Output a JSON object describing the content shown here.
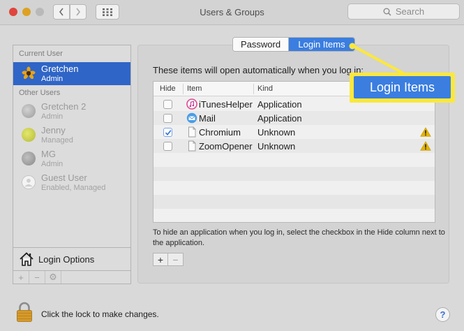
{
  "window": {
    "title": "Users & Groups",
    "search_placeholder": "Search"
  },
  "sidebar": {
    "current_user_label": "Current User",
    "other_users_label": "Other Users",
    "current_user": {
      "name": "Gretchen",
      "role": "Admin"
    },
    "other_users": [
      {
        "name": "Gretchen 2",
        "role": "Admin"
      },
      {
        "name": "Jenny",
        "role": "Managed"
      },
      {
        "name": "MG",
        "role": "Admin"
      },
      {
        "name": "Guest User",
        "role": "Enabled, Managed"
      }
    ],
    "login_options_label": "Login Options",
    "controls": [
      "+",
      "−",
      "⚙"
    ]
  },
  "tabs": [
    {
      "label": "Password",
      "active": false
    },
    {
      "label": "Login Items",
      "active": true
    }
  ],
  "panel": {
    "intro": "These items will open automatically when you log in:",
    "columns": {
      "hide": "Hide",
      "item": "Item",
      "kind": "Kind"
    },
    "items": [
      {
        "hide": false,
        "name": "iTunesHelper",
        "kind": "Application",
        "icon": "itunes-icon",
        "warning": false
      },
      {
        "hide": false,
        "name": "Mail",
        "kind": "Application",
        "icon": "mail-icon",
        "warning": false
      },
      {
        "hide": true,
        "name": "Chromium",
        "kind": "Unknown",
        "icon": "document-icon",
        "warning": true
      },
      {
        "hide": false,
        "name": "ZoomOpener",
        "kind": "Unknown",
        "icon": "document-icon",
        "warning": true
      }
    ],
    "hint": "To hide an application when you log in, select the checkbox in the Hide column next to the application.",
    "add_label": "+",
    "remove_label": "−"
  },
  "footer": {
    "lock_text": "Click the lock to make changes.",
    "help_label": "?"
  },
  "callout": {
    "label": "Login Items",
    "color": "#fbe83c"
  },
  "colors": {
    "selection": "#2f65c7",
    "accent": "#3b7ee0",
    "warning": "#e3b300"
  }
}
